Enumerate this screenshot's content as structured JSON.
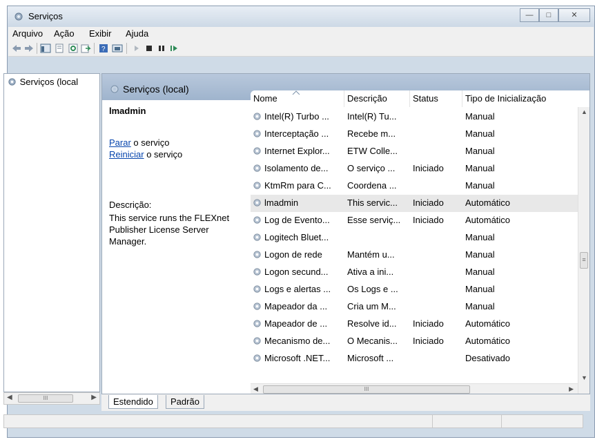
{
  "window": {
    "title": "Serviços"
  },
  "menu": [
    "Arquivo",
    "Ação",
    "Exibir",
    "Ajuda"
  ],
  "toolbar_icons": [
    "back-arrow-icon",
    "forward-arrow-icon",
    "console-tree-icon",
    "properties-icon",
    "refresh-icon",
    "export-icon",
    "help-icon",
    "view-icon",
    "play-icon",
    "stop-icon",
    "pause-icon",
    "restart-icon"
  ],
  "tree": {
    "root_label": "Serviços (local"
  },
  "header": {
    "title": "Serviços (local)"
  },
  "detail": {
    "service_name": "lmadmin",
    "stop_link": "Parar",
    "stop_suffix": " o serviço",
    "restart_link": "Reiniciar",
    "restart_suffix": " o serviço",
    "description_label": "Descrição:",
    "description_text": "This service runs the FLEXnet Publisher License Server Manager."
  },
  "columns": {
    "name": "Nome",
    "description": "Descrição",
    "status": "Status",
    "startup": "Tipo de Inicialização"
  },
  "rows": [
    {
      "name": "Intel(R) Turbo ...",
      "description": "Intel(R) Tu...",
      "status": "",
      "startup": "Manual"
    },
    {
      "name": "Interceptação ...",
      "description": "Recebe m...",
      "status": "",
      "startup": "Manual"
    },
    {
      "name": "Internet Explor...",
      "description": "ETW Colle...",
      "status": "",
      "startup": "Manual"
    },
    {
      "name": "Isolamento de...",
      "description": "O serviço ...",
      "status": "Iniciado",
      "startup": "Manual"
    },
    {
      "name": "KtmRm para C...",
      "description": "Coordena ...",
      "status": "",
      "startup": "Manual"
    },
    {
      "name": "lmadmin",
      "description": "This servic...",
      "status": "Iniciado",
      "startup": "Automático",
      "selected": true
    },
    {
      "name": "Log de Evento...",
      "description": "Esse serviç...",
      "status": "Iniciado",
      "startup": "Automático"
    },
    {
      "name": "Logitech Bluet...",
      "description": "",
      "status": "",
      "startup": "Manual"
    },
    {
      "name": "Logon de rede",
      "description": "Mantém u...",
      "status": "",
      "startup": "Manual"
    },
    {
      "name": "Logon secund...",
      "description": "Ativa a ini...",
      "status": "",
      "startup": "Manual"
    },
    {
      "name": "Logs e alertas ...",
      "description": "Os Logs e ...",
      "status": "",
      "startup": "Manual"
    },
    {
      "name": "Mapeador da ...",
      "description": "Cria um M...",
      "status": "",
      "startup": "Manual"
    },
    {
      "name": "Mapeador de ...",
      "description": "Resolve id...",
      "status": "Iniciado",
      "startup": "Automático"
    },
    {
      "name": "Mecanismo de...",
      "description": "O Mecanis...",
      "status": "Iniciado",
      "startup": "Automático"
    },
    {
      "name": "Microsoft .NET...",
      "description": "Microsoft ...",
      "status": "",
      "startup": "Desativado"
    }
  ],
  "tabs": {
    "extended": "Estendido",
    "standard": "Padrão"
  },
  "scroll_glyph": "III"
}
